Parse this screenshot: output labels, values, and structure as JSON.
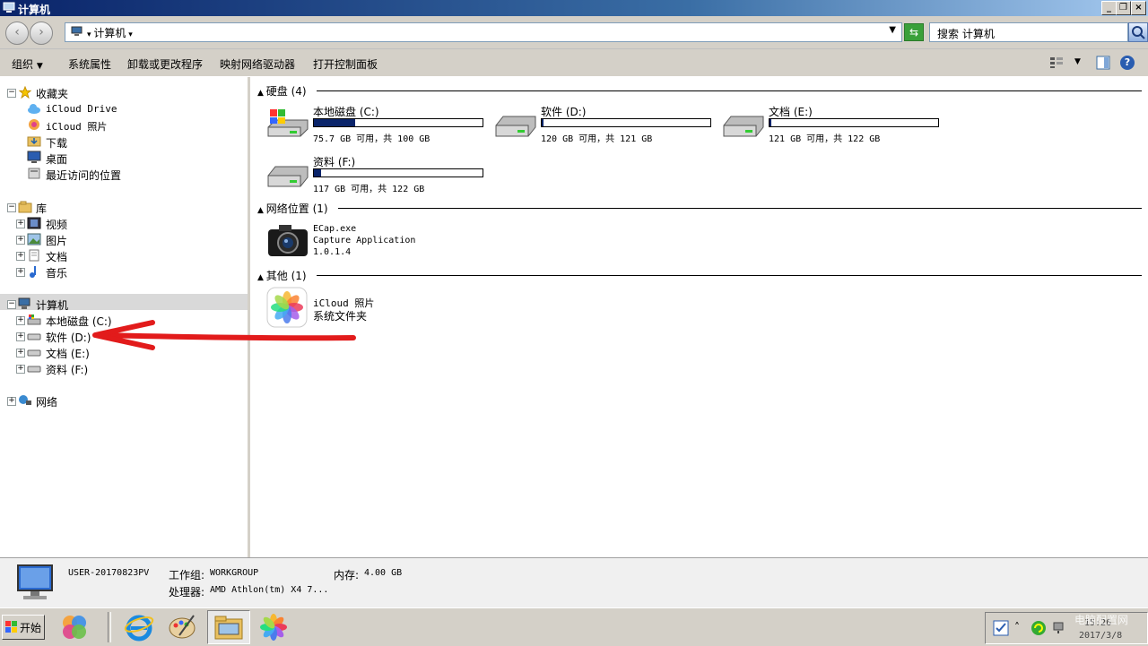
{
  "window": {
    "title": "计算机",
    "minimize": "_",
    "restore": "❐",
    "close": "×"
  },
  "address": {
    "back": "‹",
    "forward": "›",
    "path": "计算机",
    "search_placeholder": "搜索 计算机"
  },
  "toolbar": {
    "organize": "组织",
    "system_properties": "系统属性",
    "uninstall": "卸载或更改程序",
    "map_drive": "映射网络驱动器",
    "control_panel": "打开控制面板",
    "help": "?"
  },
  "sidebar": {
    "favorites": {
      "label": "收藏夹",
      "items": [
        "iCloud Drive",
        "iCloud 照片",
        "下载",
        "桌面",
        "最近访问的位置"
      ]
    },
    "libraries": {
      "label": "库",
      "items": [
        "视频",
        "图片",
        "文档",
        "音乐"
      ]
    },
    "computer": {
      "label": "计算机",
      "items": [
        "本地磁盘 (C:)",
        "软件 (D:)",
        "文档 (E:)",
        "资料 (F:)"
      ]
    },
    "network": {
      "label": "网络"
    }
  },
  "groups": {
    "hdd": {
      "label": "硬盘 (4)"
    },
    "netloc": {
      "label": "网络位置 (1)"
    },
    "other": {
      "label": "其他 (1)"
    }
  },
  "drives": [
    {
      "name": "本地磁盘 (C:)",
      "info": "75.7 GB 可用，共 100 GB",
      "used_fraction": 0.243
    },
    {
      "name": "软件 (D:)",
      "info": "120 GB 可用，共 121 GB",
      "used_fraction": 0.008
    },
    {
      "name": "文档 (E:)",
      "info": "121 GB 可用，共 122 GB",
      "used_fraction": 0.008
    },
    {
      "name": "资料 (F:)",
      "info": "117 GB 可用，共 122 GB",
      "used_fraction": 0.041
    }
  ],
  "network_item": {
    "name": "ECap.exe",
    "desc": "Capture Application",
    "version": "1.0.1.4"
  },
  "other_item": {
    "name": "iCloud 照片",
    "desc": "系统文件夹"
  },
  "details": {
    "computer_name": "USER-20170823PV",
    "workgroup_label": "工作组:",
    "workgroup": "WORKGROUP",
    "memory_label": "内存:",
    "memory": "4.00 GB",
    "processor_label": "处理器:",
    "processor": "AMD Athlon(tm) X4 7..."
  },
  "taskbar": {
    "start": "开始",
    "time": "15:26",
    "date": "2017/3/8",
    "watermark": "电脑配置网"
  },
  "colors": {
    "bar_fill": "#0a246a",
    "arrow": "#e21b1b",
    "titlebar": "#0a246a"
  }
}
